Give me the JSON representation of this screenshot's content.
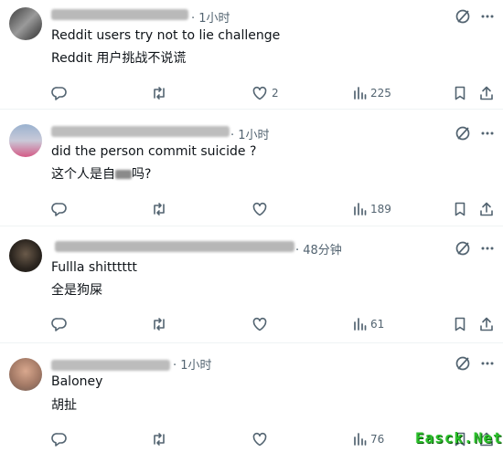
{
  "replies": [
    {
      "time": "· 1小时",
      "text_en": "Reddit users try not to lie challenge",
      "text_zh": "Reddit 用户挑战不说谎",
      "likes": "2",
      "views": "225"
    },
    {
      "time": "· 1小时",
      "text_en": "did the person commit suicide ?",
      "text_zh_prefix": "这个人是自",
      "text_zh_suffix": "吗?",
      "likes": "",
      "views": "189"
    },
    {
      "time": "· 48分钟",
      "text_en": "Fullla shitttttt",
      "text_zh": "全是狗屎",
      "likes": "",
      "views": "61"
    },
    {
      "time": "· 1小时",
      "text_en": "Baloney",
      "text_zh": "胡扯",
      "likes": "",
      "views": "76"
    }
  ],
  "watermark": "Easck.Net",
  "colors": {
    "icon_gray": "#536471",
    "divider": "#eff3f4",
    "watermark_green": "#2bbf2b"
  },
  "icons": [
    "grok-icon",
    "more-icon",
    "reply-icon",
    "retweet-icon",
    "like-icon",
    "views-icon",
    "bookmark-icon",
    "share-icon"
  ]
}
